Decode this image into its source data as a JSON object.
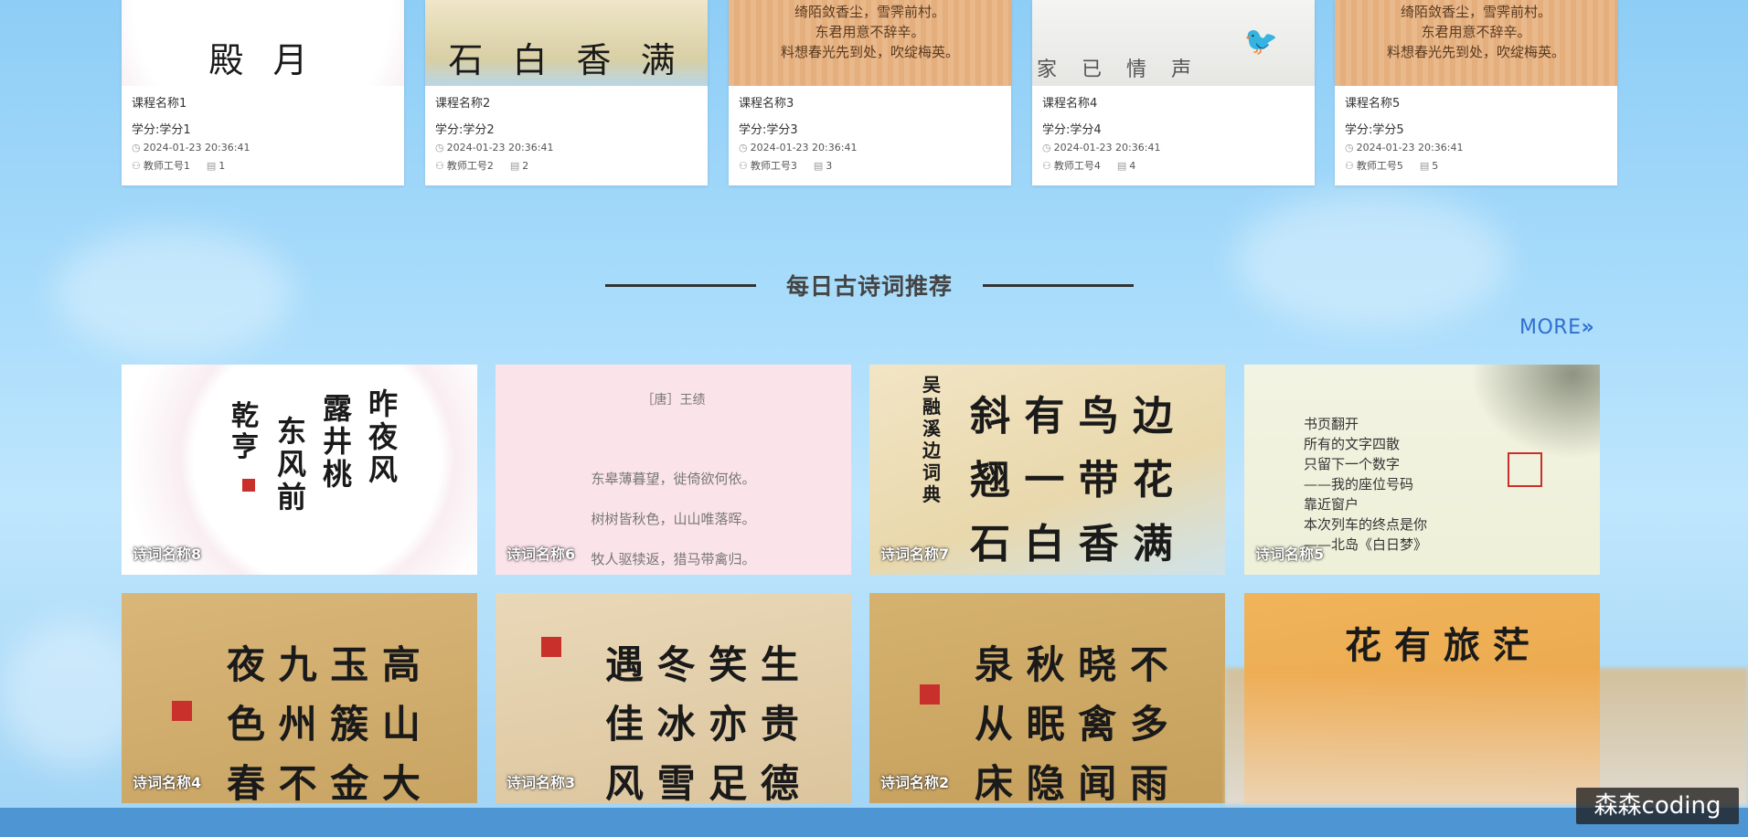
{
  "courses": [
    {
      "name": "课程名称1",
      "credit": "学分:学分1",
      "time": "2024-01-23 20:36:41",
      "teacher": "教师工号1",
      "count": "1",
      "art": "殿  月"
    },
    {
      "name": "课程名称2",
      "credit": "学分:学分2",
      "time": "2024-01-23 20:36:41",
      "teacher": "教师工号2",
      "count": "2",
      "art": "石 白 香 满"
    },
    {
      "name": "课程名称3",
      "credit": "学分:学分3",
      "time": "2024-01-23 20:36:41",
      "teacher": "教师工号3",
      "count": "3",
      "art": "绮陌敛香尘，雪霁前村。\n东君用意不辞辛。\n料想春光先到处，吹绽梅英。"
    },
    {
      "name": "课程名称4",
      "credit": "学分:学分4",
      "time": "2024-01-23 20:36:41",
      "teacher": "教师工号4",
      "count": "4",
      "art": "家 已 情 声"
    },
    {
      "name": "课程名称5",
      "credit": "学分:学分5",
      "time": "2024-01-23 20:36:41",
      "teacher": "教师工号5",
      "count": "5",
      "art": "绮陌敛香尘，雪霁前村。\n东君用意不辞辛。\n料想春光先到处，吹绽梅英。"
    }
  ],
  "section": {
    "title": "每日古诗词推荐",
    "more": "MORE"
  },
  "poems_row1": [
    {
      "name": "诗词名称8"
    },
    {
      "name": "诗词名称6",
      "author": "［唐］王绩",
      "line1": "东皋薄暮望，徙倚欲何依。",
      "line2": "树树皆秋色，山山唯落晖。",
      "line3": "牧人驱犊返，猎马带禽归。"
    },
    {
      "name": "诗词名称7",
      "art1": "斜 有 鸟 边",
      "art2": "翘 一 带 花",
      "art3": "石 白 香 满"
    },
    {
      "name": "诗词名称5",
      "text1": "书页翻开",
      "text2": "所有的文字四散",
      "text3": "只留下一个数字",
      "text4": "——我的座位号码",
      "text5": "靠近窗户",
      "text6": "本次列车的终点是你",
      "text7": "——北岛《白日梦》"
    }
  ],
  "poems_row2": [
    {
      "name": "诗词名称4",
      "art1": "夜 九 玉 高",
      "art2": "色 州 簇 山",
      "art3": "春 不 金 大"
    },
    {
      "name": "诗词名称3",
      "art1": "遇 冬 笑 生",
      "art2": "佳 冰 亦 贵",
      "art3": "风 雪 足 德"
    },
    {
      "name": "诗词名称2",
      "art1": "泉 秋 晓 不",
      "art2": "从 眠 禽 多",
      "art3": "床 隐 闻 雨"
    },
    {
      "name": "",
      "art1": "花 有 旅 茫"
    }
  ],
  "watermark": "森森coding",
  "colors": {
    "accent": "#2f6fd0",
    "title": "#444444"
  }
}
